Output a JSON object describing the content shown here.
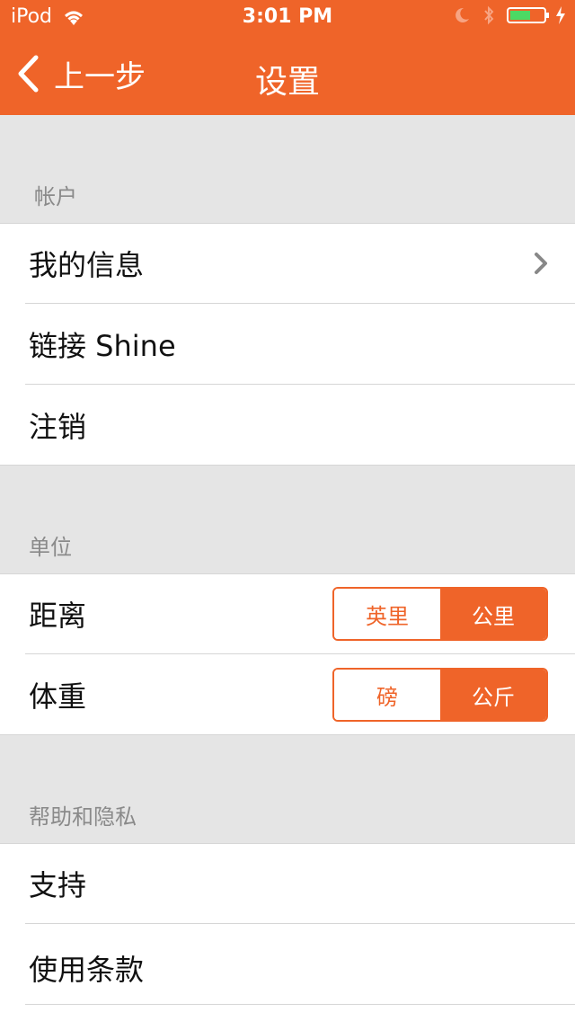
{
  "status_bar": {
    "carrier": "iPod",
    "time": "3:01 PM"
  },
  "nav": {
    "back_label": "上一步",
    "title": "设置"
  },
  "sections": {
    "account": {
      "header": "帐户",
      "rows": [
        "我的信息",
        "链接 Shine",
        "注销"
      ]
    },
    "units": {
      "header": "单位",
      "distance": {
        "label": "距离",
        "options": [
          "英里",
          "公里"
        ],
        "selected": "公里"
      },
      "weight": {
        "label": "体重",
        "options": [
          "磅",
          "公斤"
        ],
        "selected": "公斤"
      }
    },
    "help": {
      "header": "帮助和隐私",
      "rows": [
        "支持",
        "使用条款"
      ]
    }
  },
  "colors": {
    "accent": "#ef6429",
    "background": "#e5e5e5"
  }
}
